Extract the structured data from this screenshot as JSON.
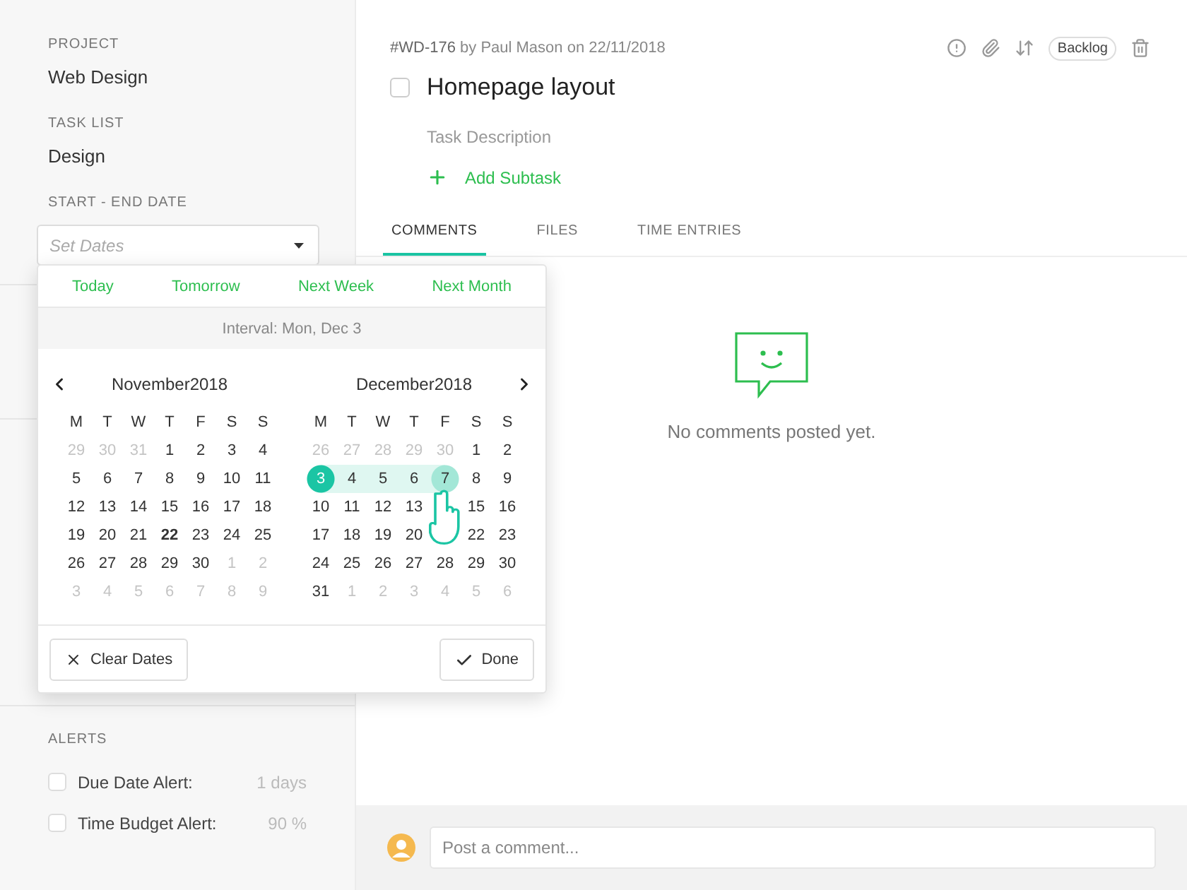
{
  "sidebar": {
    "fields": [
      {
        "label": "PROJECT",
        "value": "Web Design"
      },
      {
        "label": "TASK LIST",
        "value": "Design"
      }
    ],
    "date_field": {
      "label": "START - END DATE",
      "placeholder": "Set Dates"
    },
    "alerts": {
      "title": "ALERTS",
      "items": [
        {
          "label": "Due Date Alert:",
          "value": "1 days",
          "checked": false
        },
        {
          "label": "Time Budget Alert:",
          "value": "90 %",
          "checked": false
        }
      ]
    }
  },
  "date_picker": {
    "quick_links": [
      "Today",
      "Tomorrow",
      "Next Week",
      "Next Month"
    ],
    "interval": "Interval: Mon, Dec 3",
    "months": [
      {
        "title": "November2018",
        "weekdays": [
          "M",
          "T",
          "W",
          "T",
          "F",
          "S",
          "S"
        ],
        "weeks": [
          [
            {
              "label": "29",
              "outside": true,
              "today": false,
              "selected": false,
              "hovered": false,
              "in_range": false
            },
            {
              "label": "30",
              "outside": true,
              "today": false,
              "selected": false,
              "hovered": false,
              "in_range": false
            },
            {
              "label": "31",
              "outside": true,
              "today": false,
              "selected": false,
              "hovered": false,
              "in_range": false
            },
            {
              "label": "1",
              "outside": false,
              "today": false,
              "selected": false,
              "hovered": false,
              "in_range": false
            },
            {
              "label": "2",
              "outside": false,
              "today": false,
              "selected": false,
              "hovered": false,
              "in_range": false
            },
            {
              "label": "3",
              "outside": false,
              "today": false,
              "selected": false,
              "hovered": false,
              "in_range": false
            },
            {
              "label": "4",
              "outside": false,
              "today": false,
              "selected": false,
              "hovered": false,
              "in_range": false
            }
          ],
          [
            {
              "label": "5",
              "outside": false,
              "today": false,
              "selected": false,
              "hovered": false,
              "in_range": false
            },
            {
              "label": "6",
              "outside": false,
              "today": false,
              "selected": false,
              "hovered": false,
              "in_range": false
            },
            {
              "label": "7",
              "outside": false,
              "today": false,
              "selected": false,
              "hovered": false,
              "in_range": false
            },
            {
              "label": "8",
              "outside": false,
              "today": false,
              "selected": false,
              "hovered": false,
              "in_range": false
            },
            {
              "label": "9",
              "outside": false,
              "today": false,
              "selected": false,
              "hovered": false,
              "in_range": false
            },
            {
              "label": "10",
              "outside": false,
              "today": false,
              "selected": false,
              "hovered": false,
              "in_range": false
            },
            {
              "label": "11",
              "outside": false,
              "today": false,
              "selected": false,
              "hovered": false,
              "in_range": false
            }
          ],
          [
            {
              "label": "12",
              "outside": false,
              "today": false,
              "selected": false,
              "hovered": false,
              "in_range": false
            },
            {
              "label": "13",
              "outside": false,
              "today": false,
              "selected": false,
              "hovered": false,
              "in_range": false
            },
            {
              "label": "14",
              "outside": false,
              "today": false,
              "selected": false,
              "hovered": false,
              "in_range": false
            },
            {
              "label": "15",
              "outside": false,
              "today": false,
              "selected": false,
              "hovered": false,
              "in_range": false
            },
            {
              "label": "16",
              "outside": false,
              "today": false,
              "selected": false,
              "hovered": false,
              "in_range": false
            },
            {
              "label": "17",
              "outside": false,
              "today": false,
              "selected": false,
              "hovered": false,
              "in_range": false
            },
            {
              "label": "18",
              "outside": false,
              "today": false,
              "selected": false,
              "hovered": false,
              "in_range": false
            }
          ],
          [
            {
              "label": "19",
              "outside": false,
              "today": false,
              "selected": false,
              "hovered": false,
              "in_range": false
            },
            {
              "label": "20",
              "outside": false,
              "today": false,
              "selected": false,
              "hovered": false,
              "in_range": false
            },
            {
              "label": "21",
              "outside": false,
              "today": false,
              "selected": false,
              "hovered": false,
              "in_range": false
            },
            {
              "label": "22",
              "outside": false,
              "today": true,
              "selected": false,
              "hovered": false,
              "in_range": false
            },
            {
              "label": "23",
              "outside": false,
              "today": false,
              "selected": false,
              "hovered": false,
              "in_range": false
            },
            {
              "label": "24",
              "outside": false,
              "today": false,
              "selected": false,
              "hovered": false,
              "in_range": false
            },
            {
              "label": "25",
              "outside": false,
              "today": false,
              "selected": false,
              "hovered": false,
              "in_range": false
            }
          ],
          [
            {
              "label": "26",
              "outside": false,
              "today": false,
              "selected": false,
              "hovered": false,
              "in_range": false
            },
            {
              "label": "27",
              "outside": false,
              "today": false,
              "selected": false,
              "hovered": false,
              "in_range": false
            },
            {
              "label": "28",
              "outside": false,
              "today": false,
              "selected": false,
              "hovered": false,
              "in_range": false
            },
            {
              "label": "29",
              "outside": false,
              "today": false,
              "selected": false,
              "hovered": false,
              "in_range": false
            },
            {
              "label": "30",
              "outside": false,
              "today": false,
              "selected": false,
              "hovered": false,
              "in_range": false
            },
            {
              "label": "1",
              "outside": true,
              "today": false,
              "selected": false,
              "hovered": false,
              "in_range": false
            },
            {
              "label": "2",
              "outside": true,
              "today": false,
              "selected": false,
              "hovered": false,
              "in_range": false
            }
          ],
          [
            {
              "label": "3",
              "outside": true,
              "today": false,
              "selected": false,
              "hovered": false,
              "in_range": false
            },
            {
              "label": "4",
              "outside": true,
              "today": false,
              "selected": false,
              "hovered": false,
              "in_range": false
            },
            {
              "label": "5",
              "outside": true,
              "today": false,
              "selected": false,
              "hovered": false,
              "in_range": false
            },
            {
              "label": "6",
              "outside": true,
              "today": false,
              "selected": false,
              "hovered": false,
              "in_range": false
            },
            {
              "label": "7",
              "outside": true,
              "today": false,
              "selected": false,
              "hovered": false,
              "in_range": false
            },
            {
              "label": "8",
              "outside": true,
              "today": false,
              "selected": false,
              "hovered": false,
              "in_range": false
            },
            {
              "label": "9",
              "outside": true,
              "today": false,
              "selected": false,
              "hovered": false,
              "in_range": false
            }
          ]
        ]
      },
      {
        "title": "December2018",
        "weekdays": [
          "M",
          "T",
          "W",
          "T",
          "F",
          "S",
          "S"
        ],
        "weeks": [
          [
            {
              "label": "26",
              "outside": true,
              "today": false,
              "selected": false,
              "hovered": false,
              "in_range": false
            },
            {
              "label": "27",
              "outside": true,
              "today": false,
              "selected": false,
              "hovered": false,
              "in_range": false
            },
            {
              "label": "28",
              "outside": true,
              "today": false,
              "selected": false,
              "hovered": false,
              "in_range": false
            },
            {
              "label": "29",
              "outside": true,
              "today": false,
              "selected": false,
              "hovered": false,
              "in_range": false
            },
            {
              "label": "30",
              "outside": true,
              "today": false,
              "selected": false,
              "hovered": false,
              "in_range": false
            },
            {
              "label": "1",
              "outside": false,
              "today": false,
              "selected": false,
              "hovered": false,
              "in_range": false
            },
            {
              "label": "2",
              "outside": false,
              "today": false,
              "selected": false,
              "hovered": false,
              "in_range": false
            }
          ],
          [
            {
              "label": "3",
              "outside": false,
              "today": false,
              "selected": true,
              "hovered": false,
              "in_range": true
            },
            {
              "label": "4",
              "outside": false,
              "today": false,
              "selected": false,
              "hovered": false,
              "in_range": true
            },
            {
              "label": "5",
              "outside": false,
              "today": false,
              "selected": false,
              "hovered": false,
              "in_range": true
            },
            {
              "label": "6",
              "outside": false,
              "today": false,
              "selected": false,
              "hovered": false,
              "in_range": true
            },
            {
              "label": "7",
              "outside": false,
              "today": false,
              "selected": false,
              "hovered": true,
              "in_range": true
            },
            {
              "label": "8",
              "outside": false,
              "today": false,
              "selected": false,
              "hovered": false,
              "in_range": false
            },
            {
              "label": "9",
              "outside": false,
              "today": false,
              "selected": false,
              "hovered": false,
              "in_range": false
            }
          ],
          [
            {
              "label": "10",
              "outside": false,
              "today": false,
              "selected": false,
              "hovered": false,
              "in_range": false
            },
            {
              "label": "11",
              "outside": false,
              "today": false,
              "selected": false,
              "hovered": false,
              "in_range": false
            },
            {
              "label": "12",
              "outside": false,
              "today": false,
              "selected": false,
              "hovered": false,
              "in_range": false
            },
            {
              "label": "13",
              "outside": false,
              "today": false,
              "selected": false,
              "hovered": false,
              "in_range": false
            },
            {
              "kind": "cursor"
            },
            {
              "label": "15",
              "outside": false,
              "today": false,
              "selected": false,
              "hovered": false,
              "in_range": false
            },
            {
              "label": "16",
              "outside": false,
              "today": false,
              "selected": false,
              "hovered": false,
              "in_range": false
            }
          ],
          [
            {
              "label": "17",
              "outside": false,
              "today": false,
              "selected": false,
              "hovered": false,
              "in_range": false
            },
            {
              "label": "18",
              "outside": false,
              "today": false,
              "selected": false,
              "hovered": false,
              "in_range": false
            },
            {
              "label": "19",
              "outside": false,
              "today": false,
              "selected": false,
              "hovered": false,
              "in_range": false
            },
            {
              "label": "20",
              "outside": false,
              "today": false,
              "selected": false,
              "hovered": false,
              "in_range": false
            },
            {
              "kind": "cursor"
            },
            {
              "label": "22",
              "outside": false,
              "today": false,
              "selected": false,
              "hovered": false,
              "in_range": false
            },
            {
              "label": "23",
              "outside": false,
              "today": false,
              "selected": false,
              "hovered": false,
              "in_range": false
            }
          ],
          [
            {
              "label": "24",
              "outside": false,
              "today": false,
              "selected": false,
              "hovered": false,
              "in_range": false
            },
            {
              "label": "25",
              "outside": false,
              "today": false,
              "selected": false,
              "hovered": false,
              "in_range": false
            },
            {
              "label": "26",
              "outside": false,
              "today": false,
              "selected": false,
              "hovered": false,
              "in_range": false
            },
            {
              "label": "27",
              "outside": false,
              "today": false,
              "selected": false,
              "hovered": false,
              "in_range": false
            },
            {
              "label": "28",
              "outside": false,
              "today": false,
              "selected": false,
              "hovered": false,
              "in_range": false
            },
            {
              "label": "29",
              "outside": false,
              "today": false,
              "selected": false,
              "hovered": false,
              "in_range": false
            },
            {
              "label": "30",
              "outside": false,
              "today": false,
              "selected": false,
              "hovered": false,
              "in_range": false
            }
          ],
          [
            {
              "label": "31",
              "outside": false,
              "today": false,
              "selected": false,
              "hovered": false,
              "in_range": false
            },
            {
              "label": "1",
              "outside": true,
              "today": false,
              "selected": false,
              "hovered": false,
              "in_range": false
            },
            {
              "label": "2",
              "outside": true,
              "today": false,
              "selected": false,
              "hovered": false,
              "in_range": false
            },
            {
              "label": "3",
              "outside": true,
              "today": false,
              "selected": false,
              "hovered": false,
              "in_range": false
            },
            {
              "label": "4",
              "outside": true,
              "today": false,
              "selected": false,
              "hovered": false,
              "in_range": false
            },
            {
              "label": "5",
              "outside": true,
              "today": false,
              "selected": false,
              "hovered": false,
              "in_range": false
            },
            {
              "label": "6",
              "outside": true,
              "today": false,
              "selected": false,
              "hovered": false,
              "in_range": false
            }
          ]
        ]
      }
    ],
    "buttons": [
      {
        "kind": "clear",
        "label": "Clear Dates"
      },
      {
        "kind": "done",
        "label": "Done"
      }
    ]
  },
  "task": {
    "meta": "**#WD-176** by Paul Mason on 22/11/2018",
    "status": "Backlog",
    "completed": false,
    "title": "Homepage layout",
    "description_placeholder": "Task Description",
    "add_subtask": "Add Subtask"
  },
  "tabs": [
    {
      "label": "COMMENTS",
      "selected": true
    },
    {
      "label": "FILES",
      "selected": false
    },
    {
      "label": "TIME ENTRIES",
      "selected": false
    }
  ],
  "empty_message": "No comments posted yet.",
  "comment": {
    "placeholder": "Post a comment..."
  }
}
